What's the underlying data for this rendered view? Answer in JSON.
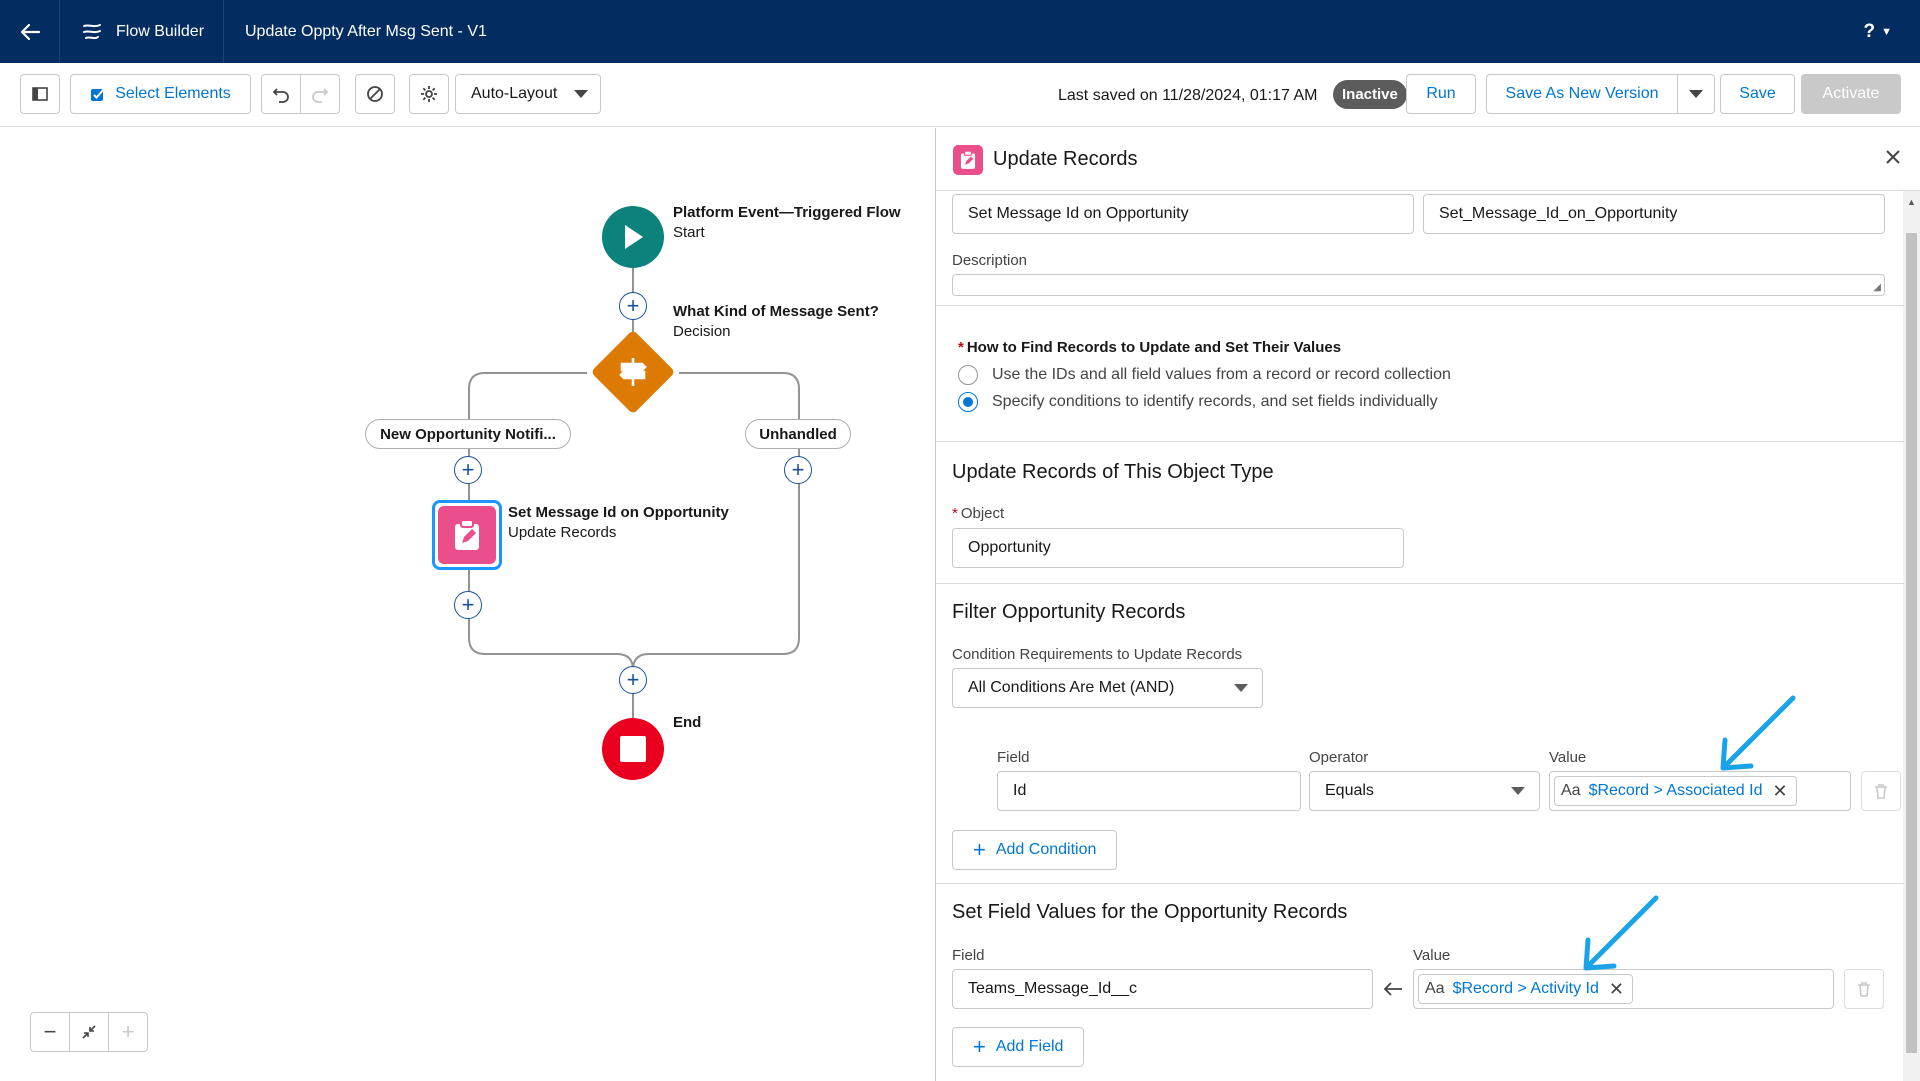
{
  "header": {
    "app_name": "Flow Builder",
    "flow_name": "Update Oppty After Msg Sent - V1",
    "help_label": "?"
  },
  "toolbar": {
    "select_elements": "Select Elements",
    "layout_mode": "Auto-Layout",
    "last_saved": "Last saved on 11/28/2024, 01:17 AM",
    "status_badge": "Inactive",
    "run": "Run",
    "save_as_new_version": "Save As New Version",
    "save": "Save",
    "activate": "Activate"
  },
  "canvas": {
    "start": {
      "title": "Platform Event—Triggered Flow",
      "subtitle": "Start"
    },
    "decision": {
      "title": "What Kind of Message Sent?",
      "subtitle": "Decision"
    },
    "branches": [
      "New Opportunity Notifi...",
      "Unhandled"
    ],
    "update": {
      "title": "Set Message Id on Opportunity",
      "subtitle": "Update Records"
    },
    "end": {
      "title": "End"
    },
    "colors": {
      "start": "#0b827c",
      "decision": "#dd7a01",
      "update": "#ea4e8b",
      "end": "#ea001e"
    }
  },
  "panel": {
    "title": "Update Records",
    "label_value": "Set Message Id on Opportunity",
    "api_name_value": "Set_Message_Id_on_Opportunity",
    "description_label": "Description",
    "how_to_label": "How to Find Records to Update and Set Their Values",
    "option_1": "Use the IDs and all field values from a record or record collection",
    "option_2": "Specify conditions to identify records, and set fields individually",
    "object_section": "Update Records of This Object Type",
    "object_label": "Object",
    "object_value": "Opportunity",
    "filter_section": "Filter Opportunity Records",
    "condition_req_label": "Condition Requirements to Update Records",
    "condition_req_value": "All Conditions Are Met (AND)",
    "cond_field_label": "Field",
    "cond_operator_label": "Operator",
    "cond_value_label": "Value",
    "cond_field_value": "Id",
    "cond_operator_value": "Equals",
    "cond_value_token": "$Record > Associated Id",
    "add_condition": "Add Condition",
    "set_section": "Set Field Values for the Opportunity Records",
    "set_field_label": "Field",
    "set_value_label": "Value",
    "set_field_value": "Teams_Message_Id__c",
    "set_value_token": "$Record > Activity Id",
    "add_field": "Add Field",
    "text_type_icon": "Aa"
  },
  "annotations": {
    "arrow_color": "#1aa3e8"
  }
}
